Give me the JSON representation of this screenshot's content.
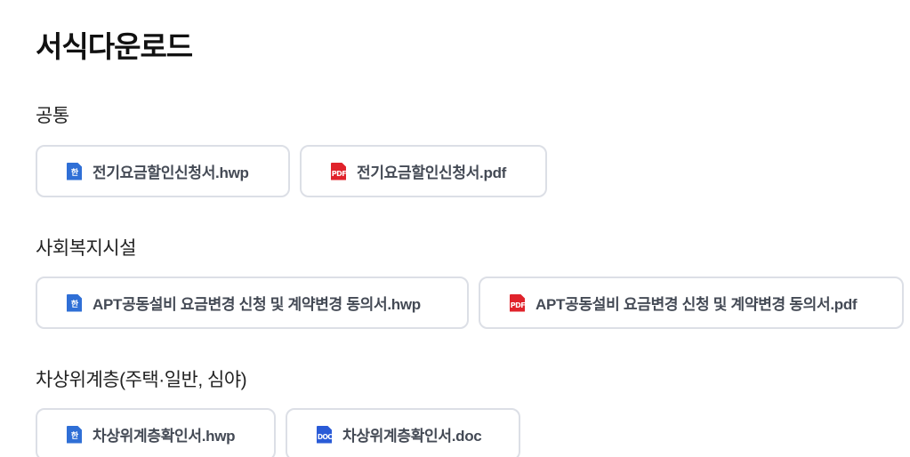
{
  "page_title": "서식다운로드",
  "sections": [
    {
      "title": "공통",
      "files": [
        {
          "label": "전기요금할인신청서.hwp",
          "icon": "hwp-file-icon",
          "icon_text": "한"
        },
        {
          "label": "전기요금할인신청서.pdf",
          "icon": "pdf-file-icon",
          "icon_text": "PDF"
        }
      ]
    },
    {
      "title": "사회복지시설",
      "files": [
        {
          "label": "APT공동설비 요금변경 신청 및 계약변경 동의서.hwp",
          "icon": "hwp-file-icon",
          "icon_text": "한"
        },
        {
          "label": "APT공동설비 요금변경 신청 및 계약변경 동의서.pdf",
          "icon": "pdf-file-icon",
          "icon_text": "PDF"
        }
      ]
    },
    {
      "title": "차상위계층(주택·일반, 심야)",
      "files": [
        {
          "label": "차상위계층확인서.hwp",
          "icon": "hwp-file-icon",
          "icon_text": "한"
        },
        {
          "label": "차상위계층확인서.doc",
          "icon": "doc-file-icon",
          "icon_text": "DOC"
        }
      ]
    }
  ],
  "colors": {
    "hwp_icon": "#2f6fd6",
    "pdf_icon": "#e0232b",
    "doc_icon": "#2a5bd7",
    "button_border": "#dcdfe6",
    "button_text": "#444a55"
  }
}
